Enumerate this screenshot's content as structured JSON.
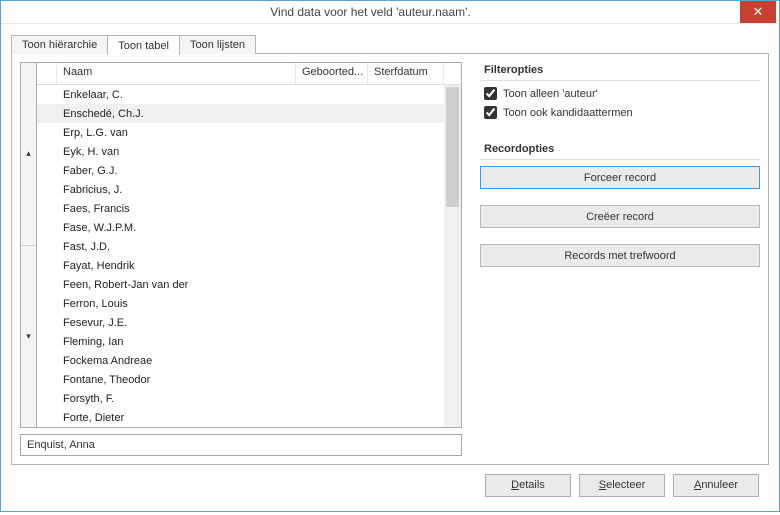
{
  "window": {
    "title": "Vind data voor het veld 'auteur.naam'."
  },
  "tabs": {
    "hierarchy": "Toon hiërarchie",
    "table": "Toon tabel",
    "lists": "Toon lijsten"
  },
  "grid": {
    "columns": {
      "name": "Naam",
      "birth": "Geboorted...",
      "death": "Sterfdatum"
    },
    "rows": [
      {
        "name": "Enkelaar, C.",
        "highlight": false
      },
      {
        "name": "Enschedé, Ch.J.",
        "highlight": true
      },
      {
        "name": "Erp, L.G. van",
        "highlight": false
      },
      {
        "name": "Eyk, H. van",
        "highlight": false
      },
      {
        "name": "Faber, G.J.",
        "highlight": false
      },
      {
        "name": "Fabricius, J.",
        "highlight": false
      },
      {
        "name": "Faes, Francis",
        "highlight": false
      },
      {
        "name": "Fase, W.J.P.M.",
        "highlight": false
      },
      {
        "name": "Fast, J.D.",
        "highlight": false
      },
      {
        "name": "Fayat, Hendrik",
        "highlight": false
      },
      {
        "name": "Feen, Robert-Jan van der",
        "highlight": false
      },
      {
        "name": "Ferron, Louis",
        "highlight": false
      },
      {
        "name": "Fesevur, J.E.",
        "highlight": false
      },
      {
        "name": "Fleming, Ian",
        "highlight": false
      },
      {
        "name": "Fockema Andreae",
        "highlight": false
      },
      {
        "name": "Fontane, Theodor",
        "highlight": false
      },
      {
        "name": "Forsyth, F.",
        "highlight": false
      },
      {
        "name": "Forte, Dieter",
        "highlight": false
      }
    ]
  },
  "search": {
    "value": "Enquist, Anna"
  },
  "filter": {
    "header": "Filteropties",
    "only_author": "Toon alleen 'auteur'",
    "candidates": "Toon ook kandidaattermen"
  },
  "record": {
    "header": "Recordopties",
    "force": "Forceer record",
    "create": "Creëer record",
    "keyword": "Records met trefwoord"
  },
  "footer": {
    "details_mn": "D",
    "details_rest": "etails",
    "select_mn": "S",
    "select_rest": "electeer",
    "cancel_mn": "A",
    "cancel_rest": "nnuleer"
  }
}
